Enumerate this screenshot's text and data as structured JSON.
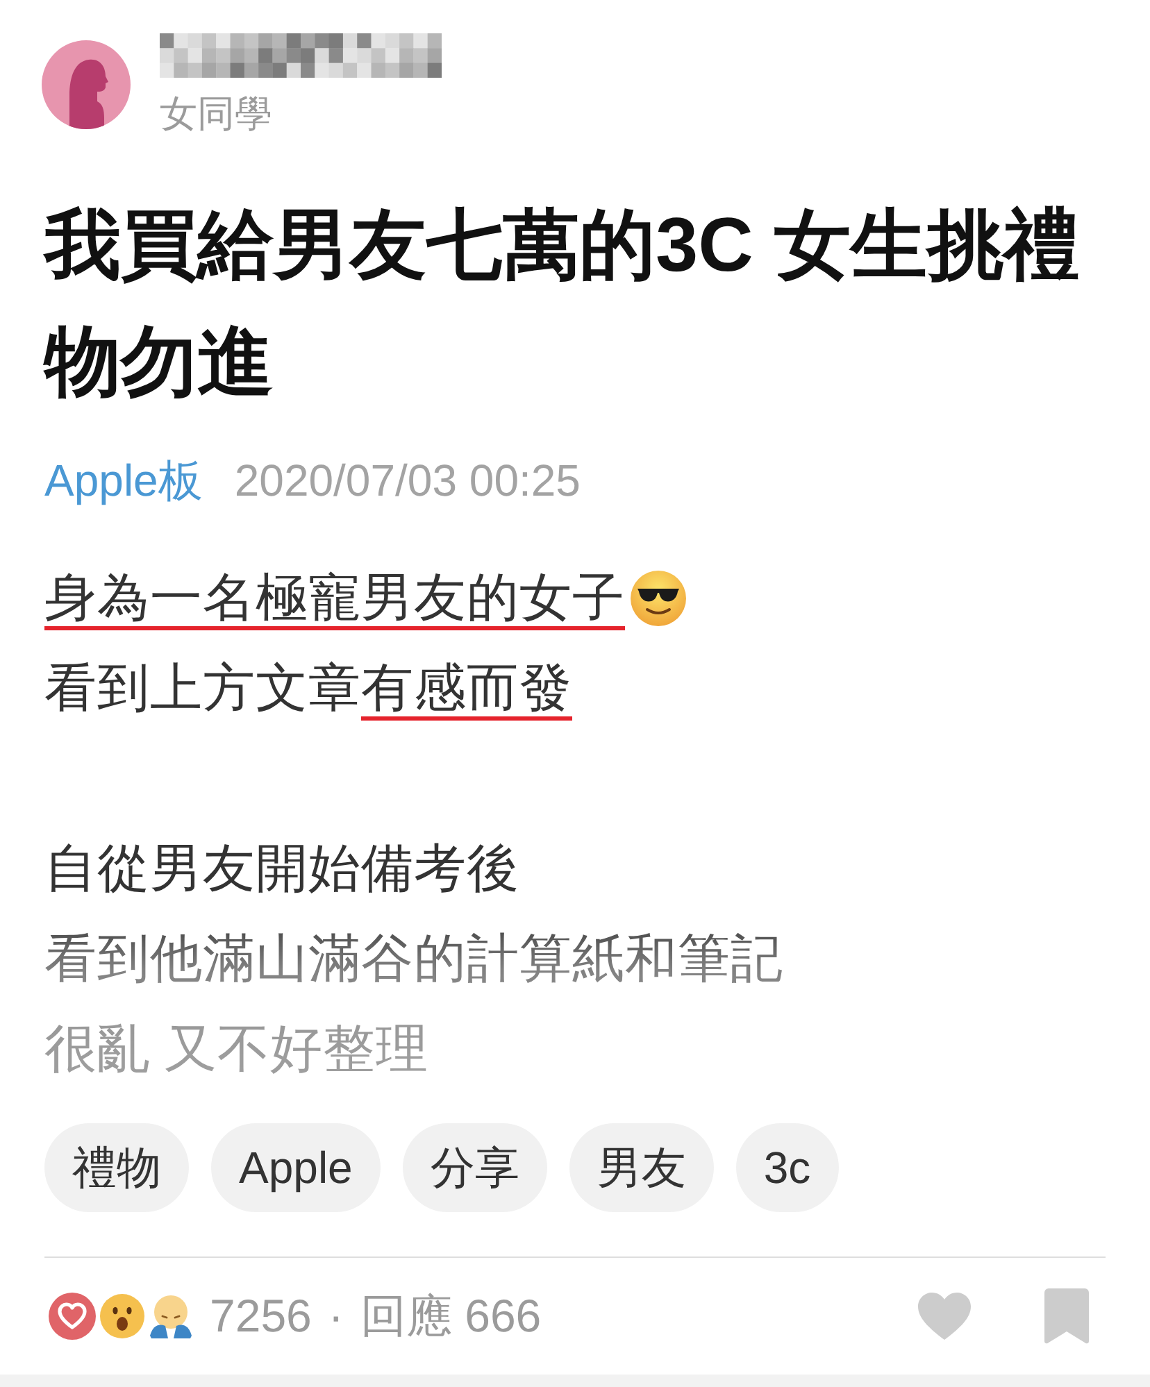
{
  "author": {
    "role": "女同學"
  },
  "post": {
    "title": "我買給男友七萬的3C 女生挑禮物勿進",
    "board": "Apple板",
    "timestamp": "2020/07/03 00:25",
    "body": [
      {
        "lines": [
          {
            "segments": [
              {
                "kind": "text",
                "text": "身為一名極寵男友的女子",
                "underlined": true
              },
              {
                "kind": "emoji"
              }
            ]
          },
          {
            "segments": [
              {
                "kind": "text",
                "text": "看到上方文章",
                "underlined": false
              },
              {
                "kind": "text",
                "text": "有感而發",
                "underlined": true
              }
            ]
          }
        ]
      },
      {
        "lines": [
          {
            "segments": [
              {
                "kind": "text",
                "text": "自從男友開始備考後",
                "underlined": false
              }
            ]
          },
          {
            "segments": [
              {
                "kind": "text",
                "text": "看到他滿山滿谷的計算紙和筆記",
                "underlined": false
              }
            ]
          },
          {
            "segments": [
              {
                "kind": "text",
                "text": "很亂 又不好整理",
                "underlined": false
              }
            ]
          }
        ]
      }
    ],
    "tags": [
      "禮物",
      "Apple",
      "分享",
      "男友",
      "3c"
    ]
  },
  "stats": {
    "reactions": "7256",
    "separator": "·",
    "comments": "回應 666"
  }
}
